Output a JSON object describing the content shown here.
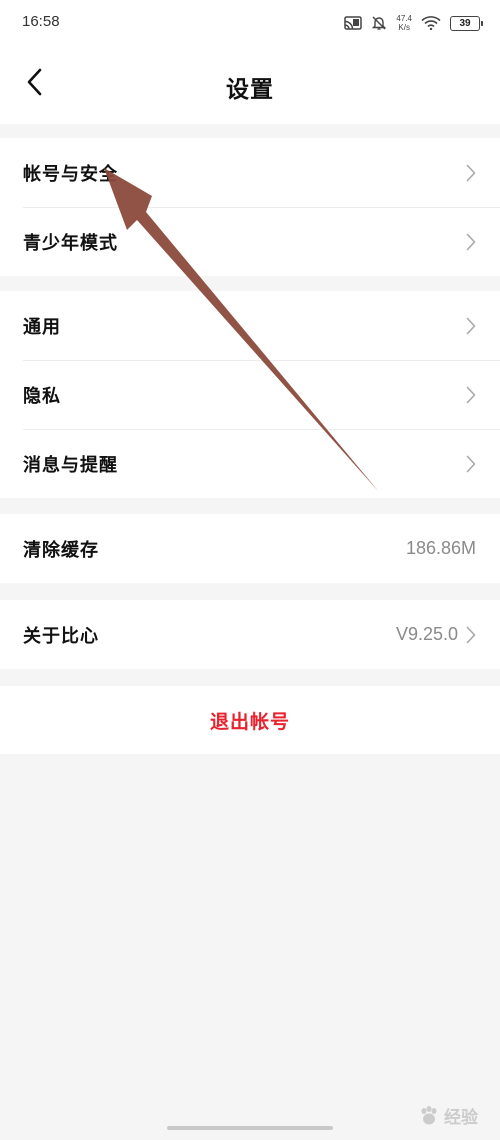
{
  "status_bar": {
    "time": "16:58",
    "net_speed_value": "47.4",
    "net_speed_unit": "K/s",
    "battery": "39",
    "icons": [
      "cast-icon",
      "bell-off-icon",
      "wifi-icon",
      "battery-icon"
    ]
  },
  "nav": {
    "back_icon": "chevron-left-icon",
    "title": "设置"
  },
  "groups": [
    {
      "items": [
        {
          "label": "帐号与安全",
          "value": "",
          "chevron": true
        },
        {
          "label": "青少年模式",
          "value": "",
          "chevron": true
        }
      ]
    },
    {
      "items": [
        {
          "label": "通用",
          "value": "",
          "chevron": true
        },
        {
          "label": "隐私",
          "value": "",
          "chevron": true
        },
        {
          "label": "消息与提醒",
          "value": "",
          "chevron": true
        }
      ]
    },
    {
      "items": [
        {
          "label": "清除缓存",
          "value": "186.86M",
          "chevron": false
        }
      ]
    },
    {
      "items": [
        {
          "label": "关于比心",
          "value": "V9.25.0",
          "chevron": true
        }
      ]
    }
  ],
  "logout": {
    "label": "退出帐号",
    "color": "#e6232f"
  },
  "annotation": {
    "arrow_color": "#8b4a3c"
  },
  "watermark": {
    "text": "经验",
    "logo": "baidu-paw-icon"
  }
}
